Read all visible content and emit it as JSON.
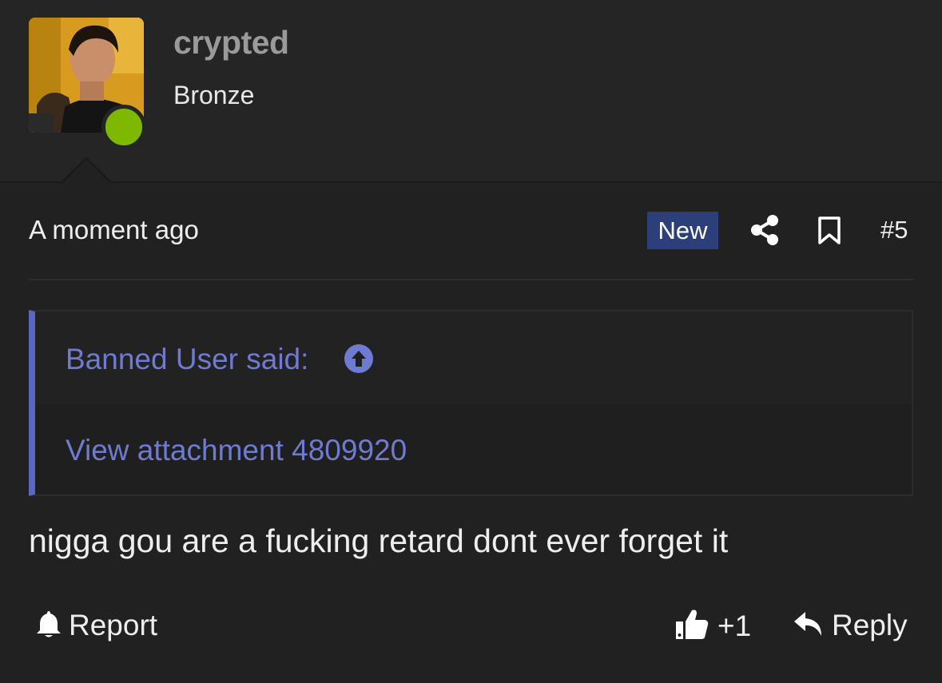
{
  "user": {
    "username": "crypted",
    "rank": "Bronze",
    "status": "online",
    "status_color": "#7fb800",
    "avatar_icon": "user-photo"
  },
  "post": {
    "timestamp": "A moment ago",
    "badge": "New",
    "number": "#5",
    "body": "nigga gou are a fucking retard dont ever forget it"
  },
  "quote": {
    "author_line": "Banned User said:",
    "attachment_link": "View attachment 4809920"
  },
  "actions": {
    "report_label": "Report",
    "like_count": "+1",
    "reply_label": "Reply"
  },
  "colors": {
    "background": "#212121",
    "accent": "#5a66c0",
    "link": "#6f7bd2",
    "badge": "#2c3f7a"
  },
  "icons": [
    "share-icon",
    "bookmark-icon",
    "arrow-up-circle-icon",
    "bell-icon",
    "thumbs-up-icon",
    "reply-icon"
  ]
}
